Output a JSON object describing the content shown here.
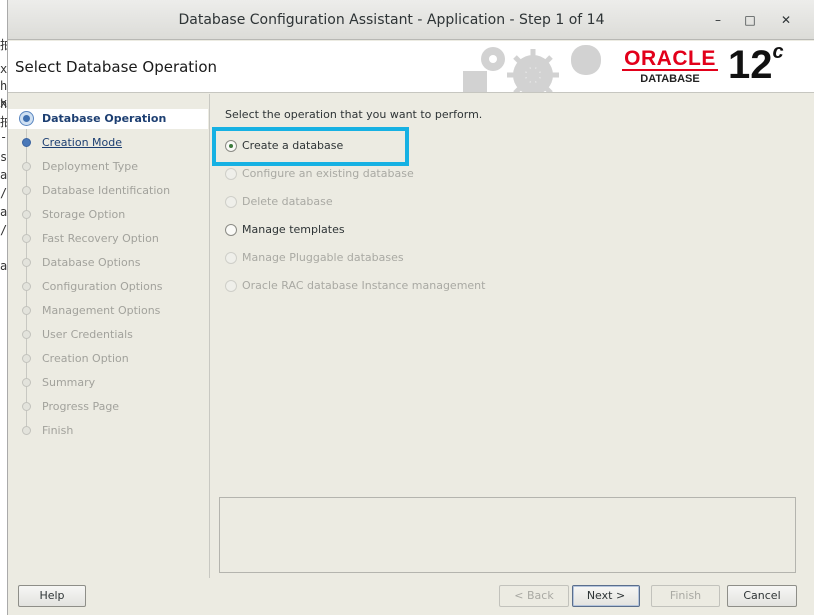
{
  "background_terminal": {
    "chars": [
      "拍",
      "x",
      "h",
      "x",
      "h",
      "拍",
      "-",
      "s",
      "a",
      "/",
      "a",
      "/",
      "a"
    ]
  },
  "window": {
    "title": "Database Configuration Assistant - Application - Step 1 of 14",
    "controls": {
      "minimize": "–",
      "maximize": "□",
      "close": "✕"
    }
  },
  "header": {
    "heading": "Select Database Operation",
    "logo": {
      "brand": "ORACLE",
      "product": "DATABASE",
      "version": "12",
      "version_suffix": "c"
    }
  },
  "sidebar": {
    "steps": [
      {
        "label": "Database Operation",
        "state": "active"
      },
      {
        "label": "Creation Mode",
        "state": "next"
      },
      {
        "label": "Deployment Type",
        "state": "pending"
      },
      {
        "label": "Database Identification",
        "state": "pending"
      },
      {
        "label": "Storage Option",
        "state": "pending"
      },
      {
        "label": "Fast Recovery Option",
        "state": "pending"
      },
      {
        "label": "Database Options",
        "state": "pending"
      },
      {
        "label": "Configuration Options",
        "state": "pending"
      },
      {
        "label": "Management Options",
        "state": "pending"
      },
      {
        "label": "User Credentials",
        "state": "pending"
      },
      {
        "label": "Creation Option",
        "state": "pending"
      },
      {
        "label": "Summary",
        "state": "pending"
      },
      {
        "label": "Progress Page",
        "state": "pending"
      },
      {
        "label": "Finish",
        "state": "pending"
      }
    ]
  },
  "content": {
    "prompt": "Select the operation that you want to perform.",
    "options": [
      {
        "label": "Create a database",
        "checked": true,
        "enabled": true
      },
      {
        "label": "Configure an existing database",
        "checked": false,
        "enabled": false
      },
      {
        "label": "Delete database",
        "checked": false,
        "enabled": false
      },
      {
        "label": "Manage templates",
        "checked": false,
        "enabled": true
      },
      {
        "label": "Manage Pluggable databases",
        "checked": false,
        "enabled": false
      },
      {
        "label": "Oracle RAC database Instance management",
        "checked": false,
        "enabled": false
      }
    ]
  },
  "footer": {
    "help": "Help",
    "back": "< Back",
    "next": "Next >",
    "finish": "Finish",
    "cancel": "Cancel"
  },
  "colors": {
    "highlight": "#16b1e3",
    "oracle_red": "#e2001a",
    "step_active": "#1d3f72"
  }
}
